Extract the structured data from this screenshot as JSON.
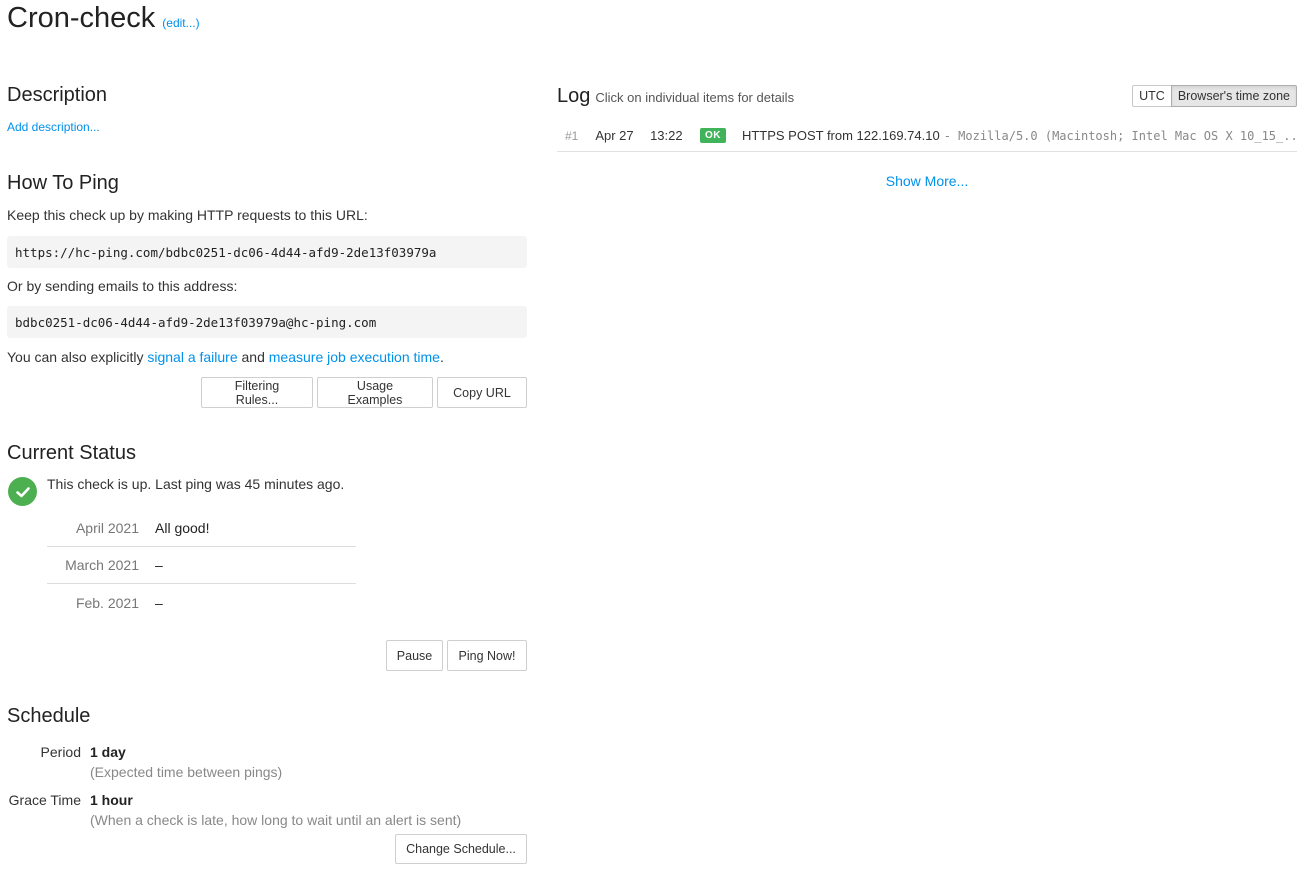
{
  "header": {
    "title": "Cron-check",
    "edit_label": "(edit...)"
  },
  "description": {
    "heading": "Description",
    "add_label": "Add description..."
  },
  "how_to_ping": {
    "heading": "How To Ping",
    "url_intro": "Keep this check up by making HTTP requests to this URL:",
    "ping_url": "https://hc-ping.com/bdbc0251-dc06-4d44-afd9-2de13f03979a",
    "email_intro": "Or by sending emails to this address:",
    "ping_email": "bdbc0251-dc06-4d44-afd9-2de13f03979a@hc-ping.com",
    "also_prefix": "You can also explicitly ",
    "signal_failure_link": "signal a failure",
    "also_and": " and ",
    "measure_time_link": "measure job execution time",
    "also_suffix": ".",
    "buttons": {
      "filtering_rules": "Filtering Rules...",
      "usage_examples": "Usage Examples",
      "copy_url": "Copy URL"
    }
  },
  "current_status": {
    "heading": "Current Status",
    "status": "up",
    "status_icon": "check-circle-icon",
    "status_color": "#4caf50",
    "status_text": "This check is up. Last ping was 45 minutes ago.",
    "months": [
      {
        "label": "April 2021",
        "value": "All good!"
      },
      {
        "label": "March 2021",
        "value": "–"
      },
      {
        "label": "Feb. 2021",
        "value": "–"
      }
    ],
    "buttons": {
      "pause": "Pause",
      "ping_now": "Ping Now!"
    }
  },
  "schedule": {
    "heading": "Schedule",
    "period_label": "Period",
    "period_value": "1 day",
    "period_hint": "(Expected time between pings)",
    "grace_label": "Grace Time",
    "grace_value": "1 hour",
    "grace_hint": "(When a check is late, how long to wait until an alert is sent)",
    "change_button": "Change Schedule..."
  },
  "log": {
    "heading": "Log",
    "subheading": "Click on individual items for details",
    "timezone_options": [
      "UTC",
      "Browser's time zone"
    ],
    "timezone_selected": "Browser's time zone",
    "entries": [
      {
        "n": "#1",
        "date": "Apr 27",
        "time": "13:22",
        "badge": "OK",
        "badge_color": "#40b35b",
        "event": "HTTPS POST from 122.169.74.10",
        "user_agent": "- Mozilla/5.0 (Macintosh; Intel Mac OS X 10_15_..."
      }
    ],
    "show_more": "Show More..."
  },
  "colors": {
    "link": "#0091ea",
    "ok_green": "#40b35b"
  }
}
